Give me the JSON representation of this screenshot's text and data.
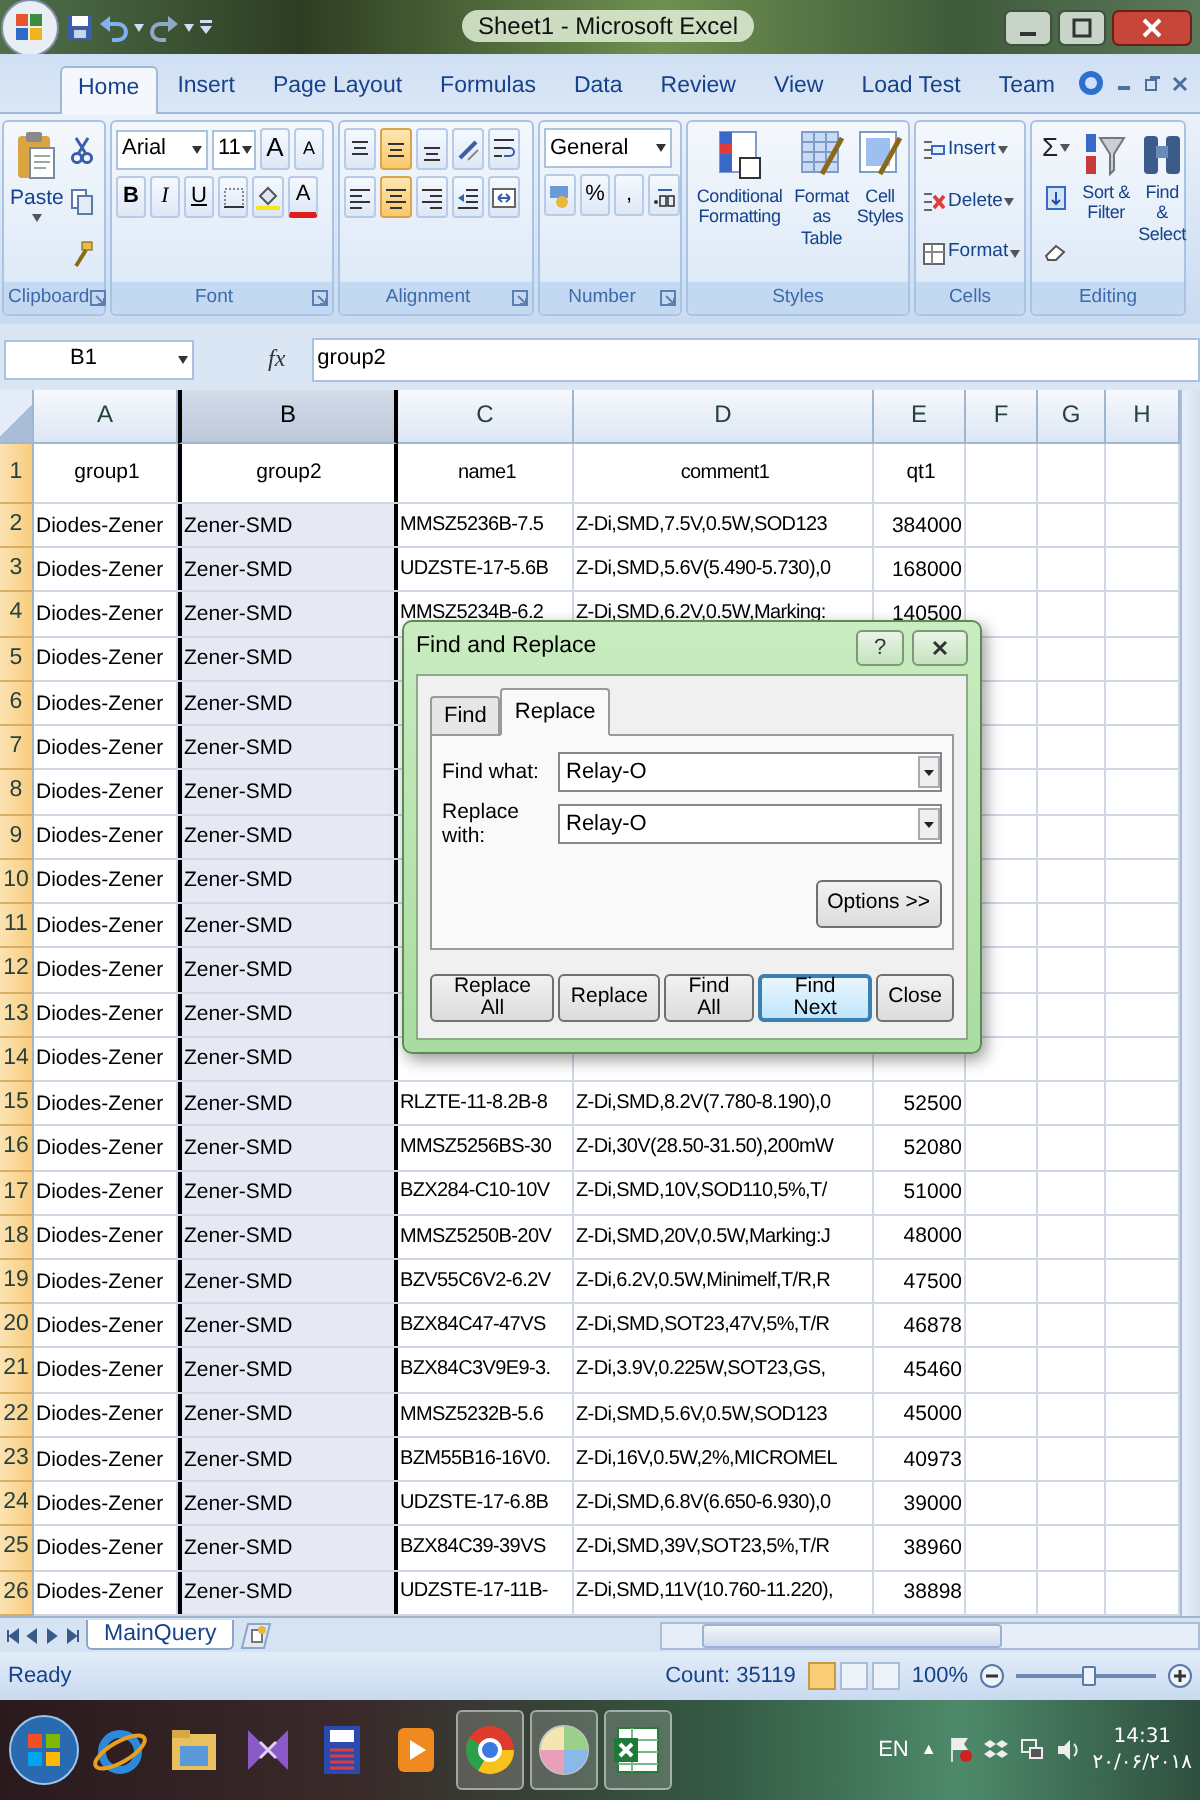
{
  "window": {
    "title": "Sheet1 - Microsoft Excel"
  },
  "ribbon_tabs": [
    {
      "label": "Home",
      "selected": true
    },
    {
      "label": "Insert",
      "selected": false
    },
    {
      "label": "Page Layout",
      "selected": false
    },
    {
      "label": "Formulas",
      "selected": false
    },
    {
      "label": "Data",
      "selected": false
    },
    {
      "label": "Review",
      "selected": false
    },
    {
      "label": "View",
      "selected": false
    },
    {
      "label": "Load Test",
      "selected": false
    },
    {
      "label": "Team",
      "selected": false
    }
  ],
  "ribbon": {
    "clipboard": {
      "label": "Clipboard",
      "paste": "Paste"
    },
    "font": {
      "label": "Font",
      "name": "Arial",
      "size": "11",
      "grow": "A",
      "shrink": "A",
      "bold": "B",
      "italic": "I",
      "underline": "U",
      "font_color": "A"
    },
    "alignment": {
      "label": "Alignment",
      "vertical": [
        {
          "selected": false
        },
        {
          "selected": true
        },
        {
          "selected": false
        }
      ],
      "horizontal": [
        {
          "selected": false
        },
        {
          "selected": true
        },
        {
          "selected": false
        }
      ]
    },
    "number": {
      "label": "Number",
      "format": "General",
      "percent": "%",
      "comma": ","
    },
    "styles": {
      "label": "Styles",
      "buttons": [
        "Conditional Formatting",
        "Format as Table",
        "Cell Styles"
      ]
    },
    "cells": {
      "label": "Cells",
      "buttons": [
        "Insert",
        "Delete",
        "Format"
      ]
    },
    "editing": {
      "label": "Editing",
      "sum": "Σ",
      "buttons": [
        "Sort & Filter",
        "Find & Select"
      ]
    }
  },
  "formula_bar": {
    "name_box": "B1",
    "fx": "fx",
    "value": "group2"
  },
  "sheet": {
    "columns": [
      {
        "label": "A",
        "selected": false
      },
      {
        "label": "B",
        "selected": true
      },
      {
        "label": "C",
        "selected": false
      },
      {
        "label": "D",
        "selected": false
      },
      {
        "label": "E",
        "selected": false
      },
      {
        "label": "F",
        "selected": false
      },
      {
        "label": "G",
        "selected": false
      },
      {
        "label": "H",
        "selected": false
      }
    ],
    "rows": [
      {
        "number": "1",
        "cells": [
          "group1",
          "group2",
          "name1",
          "comment1",
          "qt1"
        ]
      },
      {
        "number": "2",
        "cells": [
          "Diodes-Zener",
          "Zener-SMD",
          "MMSZ5236B-7.5",
          "Z-Di,SMD,7.5V,0.5W,SOD123",
          "384000"
        ]
      },
      {
        "number": "3",
        "cells": [
          "Diodes-Zener",
          "Zener-SMD",
          "UDZSTE-17-5.6B",
          "Z-Di,SMD,5.6V(5.490-5.730),0",
          "168000"
        ]
      },
      {
        "number": "4",
        "cells": [
          "Diodes-Zener",
          "Zener-SMD",
          "MMSZ5234B-6.2",
          "Z-Di,SMD,6.2V,0.5W,Marking:",
          "140500"
        ]
      },
      {
        "number": "5",
        "cells": [
          "Diodes-Zener",
          "Zener-SMD"
        ]
      },
      {
        "number": "6",
        "cells": [
          "Diodes-Zener",
          "Zener-SMD"
        ]
      },
      {
        "number": "7",
        "cells": [
          "Diodes-Zener",
          "Zener-SMD"
        ]
      },
      {
        "number": "8",
        "cells": [
          "Diodes-Zener",
          "Zener-SMD"
        ]
      },
      {
        "number": "9",
        "cells": [
          "Diodes-Zener",
          "Zener-SMD"
        ]
      },
      {
        "number": "10",
        "cells": [
          "Diodes-Zener",
          "Zener-SMD"
        ]
      },
      {
        "number": "11",
        "cells": [
          "Diodes-Zener",
          "Zener-SMD"
        ]
      },
      {
        "number": "12",
        "cells": [
          "Diodes-Zener",
          "Zener-SMD"
        ]
      },
      {
        "number": "13",
        "cells": [
          "Diodes-Zener",
          "Zener-SMD"
        ]
      },
      {
        "number": "14",
        "cells": [
          "Diodes-Zener",
          "Zener-SMD"
        ]
      },
      {
        "number": "15",
        "cells": [
          "Diodes-Zener",
          "Zener-SMD",
          "RLZTE-11-8.2B-8",
          "Z-Di,SMD,8.2V(7.780-8.190),0",
          "52500"
        ]
      },
      {
        "number": "16",
        "cells": [
          "Diodes-Zener",
          "Zener-SMD",
          "MMSZ5256BS-30",
          "Z-Di,30V(28.50-31.50),200mW",
          "52080"
        ]
      },
      {
        "number": "17",
        "cells": [
          "Diodes-Zener",
          "Zener-SMD",
          "BZX284-C10-10V",
          "Z-Di,SMD,10V,SOD110,5%,T/",
          "51000"
        ]
      },
      {
        "number": "18",
        "cells": [
          "Diodes-Zener",
          "Zener-SMD",
          "MMSZ5250B-20V",
          "Z-Di,SMD,20V,0.5W,Marking:J",
          "48000"
        ]
      },
      {
        "number": "19",
        "cells": [
          "Diodes-Zener",
          "Zener-SMD",
          "BZV55C6V2-6.2V",
          "Z-Di,6.2V,0.5W,Minimelf,T/R,R",
          "47500"
        ]
      },
      {
        "number": "20",
        "cells": [
          "Diodes-Zener",
          "Zener-SMD",
          "BZX84C47-47VS",
          "Z-Di,SMD,SOT23,47V,5%,T/R",
          "46878"
        ]
      },
      {
        "number": "21",
        "cells": [
          "Diodes-Zener",
          "Zener-SMD",
          "BZX84C3V9E9-3.",
          "Z-Di,3.9V,0.225W,SOT23,GS,",
          "45460"
        ]
      },
      {
        "number": "22",
        "cells": [
          "Diodes-Zener",
          "Zener-SMD",
          "MMSZ5232B-5.6",
          "Z-Di,SMD,5.6V,0.5W,SOD123",
          "45000"
        ]
      },
      {
        "number": "23",
        "cells": [
          "Diodes-Zener",
          "Zener-SMD",
          "BZM55B16-16V0.",
          "Z-Di,16V,0.5W,2%,MICROMEL",
          "40973"
        ]
      },
      {
        "number": "24",
        "cells": [
          "Diodes-Zener",
          "Zener-SMD",
          "UDZSTE-17-6.8B",
          "Z-Di,SMD,6.8V(6.650-6.930),0",
          "39000"
        ]
      },
      {
        "number": "25",
        "cells": [
          "Diodes-Zener",
          "Zener-SMD",
          "BZX84C39-39VS",
          "Z-Di,SMD,39V,SOT23,5%,T/R",
          "38960"
        ]
      },
      {
        "number": "26",
        "cells": [
          "Diodes-Zener",
          "Zener-SMD",
          "UDZSTE-17-11B-",
          "Z-Di,SMD,11V(10.760-11.220),",
          "38898"
        ]
      }
    ]
  },
  "dialog": {
    "title": "Find and Replace",
    "help": "?",
    "tabs": [
      {
        "label": "Find",
        "selected": false
      },
      {
        "label": "Replace",
        "selected": true
      }
    ],
    "fields": [
      {
        "label": "Find what:",
        "value": "Relay-O"
      },
      {
        "label": "Replace with:",
        "value": "Relay-O"
      }
    ],
    "options": "Options >>",
    "buttons": [
      {
        "label": "Replace All",
        "default": false
      },
      {
        "label": "Replace",
        "default": false
      },
      {
        "label": "Find All",
        "default": false
      },
      {
        "label": "Find Next",
        "default": true
      },
      {
        "label": "Close",
        "default": false
      }
    ]
  },
  "sheet_tabs": [
    {
      "label": "MainQuery",
      "selected": true
    }
  ],
  "status_bar": {
    "mode": "Ready",
    "count": "Count: 35119",
    "zoom": {
      "reading": "100%",
      "level": 0.52
    }
  },
  "taskbar": {
    "apps": [
      {
        "running": false
      },
      {
        "running": false
      },
      {
        "running": false
      },
      {
        "running": false
      },
      {
        "running": false
      },
      {
        "running": true
      },
      {
        "running": true
      },
      {
        "running": true
      }
    ],
    "language": "EN",
    "tray_arrow": "▲",
    "time": "14:31",
    "date": "۲۰/۰۶/۲۰۱۸"
  }
}
